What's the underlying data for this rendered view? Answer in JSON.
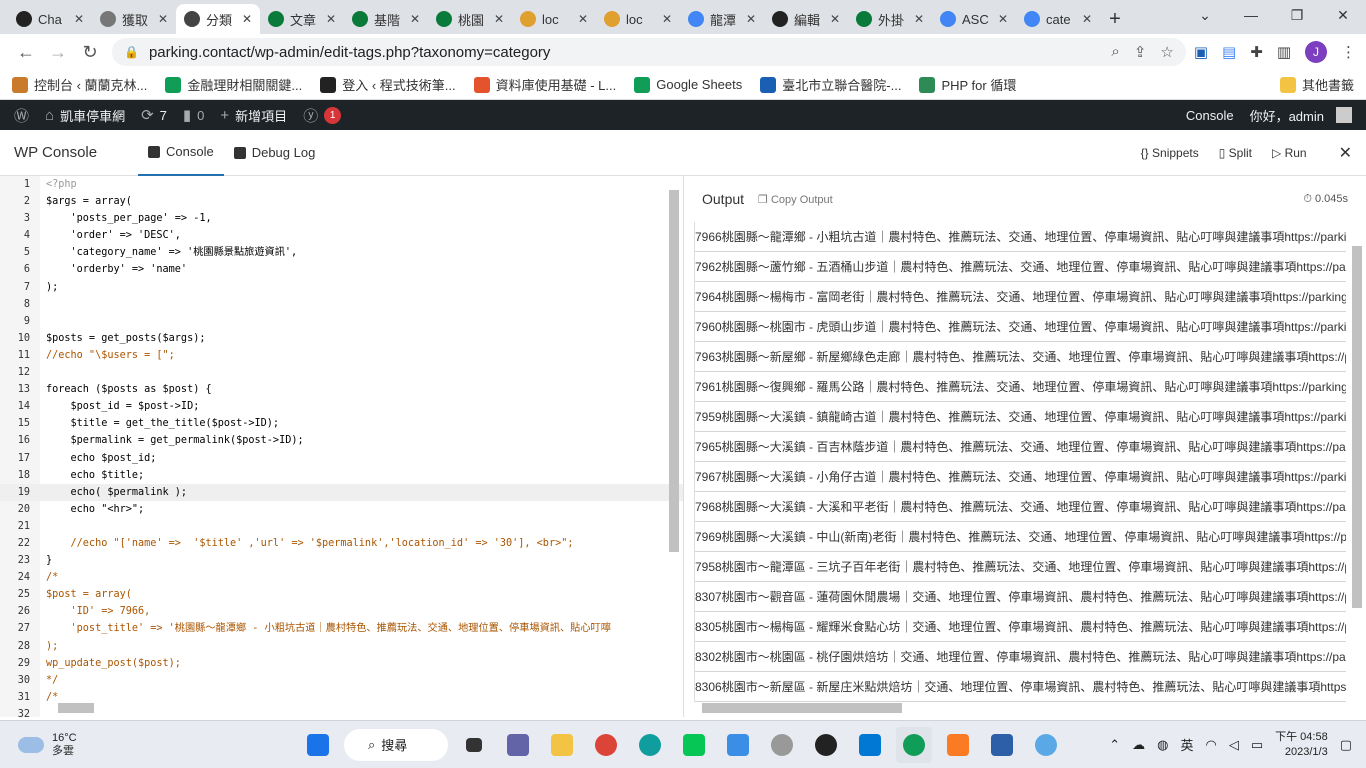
{
  "browser": {
    "tabs": [
      {
        "label": "Cha",
        "color": "#222"
      },
      {
        "label": "獲取",
        "color": "#777"
      },
      {
        "label": "分類",
        "color": "#444"
      },
      {
        "label": "文章",
        "color": "#0a7a3a"
      },
      {
        "label": "基階",
        "color": "#0a7a3a"
      },
      {
        "label": "桃園",
        "color": "#0a7a3a"
      },
      {
        "label": "loc",
        "color": "#e0a030"
      },
      {
        "label": "loc",
        "color": "#e0a030"
      },
      {
        "label": "龍潭",
        "color": "#4285f4"
      },
      {
        "label": "編輯",
        "color": "#222"
      },
      {
        "label": "外掛",
        "color": "#0a7a3a"
      },
      {
        "label": "ASC",
        "color": "#4285f4"
      },
      {
        "label": "cate",
        "color": "#4285f4"
      }
    ],
    "active_tab_index": 2,
    "new_tab": "+",
    "url": "parking.contact/wp-admin/edit-tags.php?taxonomy=category",
    "profile_initial": "J",
    "bookmarks": [
      {
        "label": "控制台 ‹ 蘭蘭克林...",
        "color": "#c97a2b"
      },
      {
        "label": "金融理財相關關鍵...",
        "color": "#0f9d58"
      },
      {
        "label": "登入 ‹ 程式技術筆...",
        "color": "#222"
      },
      {
        "label": "資料庫使用基礎 - L...",
        "color": "#e4532b"
      },
      {
        "label": "Google Sheets",
        "color": "#0f9d58"
      },
      {
        "label": "臺北市立聯合醫院-...",
        "color": "#1a5fb4"
      },
      {
        "label": "PHP for 循環",
        "color": "#2e8b57"
      }
    ],
    "other_bookmarks": "其他書籤"
  },
  "adminbar": {
    "site_name": "凱車停車網",
    "updates_count": "7",
    "comments_count": "0",
    "new_item": "新增項目",
    "notification_count": "1",
    "console_label": "Console",
    "greeting": "你好，admin"
  },
  "console": {
    "title": "WP Console",
    "tabs": [
      "Console",
      "Debug Log"
    ],
    "actions": {
      "snippets": "Snippets",
      "split": "Split",
      "run": "Run"
    }
  },
  "editor": {
    "current_line": 19,
    "lines": [
      {
        "n": "1",
        "code": "<?php",
        "cls": "c-php"
      },
      {
        "n": "2",
        "code": "$args = array(",
        "cls": ""
      },
      {
        "n": "3",
        "code": "    'posts_per_page' => -1,",
        "cls": ""
      },
      {
        "n": "4",
        "code": "    'order' => 'DESC',",
        "cls": ""
      },
      {
        "n": "5",
        "code": "    'category_name' => '桃園縣景點旅遊資訊',",
        "cls": ""
      },
      {
        "n": "6",
        "code": "    'orderby' => 'name'",
        "cls": ""
      },
      {
        "n": "7",
        "code": ");",
        "cls": ""
      },
      {
        "n": "8",
        "code": "",
        "cls": ""
      },
      {
        "n": "9",
        "code": "",
        "cls": ""
      },
      {
        "n": "10",
        "code": "$posts = get_posts($args);",
        "cls": ""
      },
      {
        "n": "11",
        "code": "//echo \"\\$users = [\";",
        "cls": "c-com"
      },
      {
        "n": "12",
        "code": "",
        "cls": ""
      },
      {
        "n": "13",
        "code": "foreach ($posts as $post) {",
        "cls": ""
      },
      {
        "n": "14",
        "code": "    $post_id = $post->ID;",
        "cls": ""
      },
      {
        "n": "15",
        "code": "    $title = get_the_title($post->ID);",
        "cls": ""
      },
      {
        "n": "16",
        "code": "    $permalink = get_permalink($post->ID);",
        "cls": ""
      },
      {
        "n": "17",
        "code": "    echo $post_id;",
        "cls": ""
      },
      {
        "n": "18",
        "code": "    echo $title;",
        "cls": ""
      },
      {
        "n": "19",
        "code": "    echo( $permalink );",
        "cls": ""
      },
      {
        "n": "20",
        "code": "    echo \"<hr>\";",
        "cls": ""
      },
      {
        "n": "21",
        "code": "",
        "cls": ""
      },
      {
        "n": "22",
        "code": "    //echo \"['name' =>  '$title' ,'url' => '$permalink','location_id' => '30'], <br>\";",
        "cls": "c-com"
      },
      {
        "n": "23",
        "code": "}",
        "cls": ""
      },
      {
        "n": "24",
        "code": "/*",
        "cls": "c-com"
      },
      {
        "n": "25",
        "code": "$post = array(",
        "cls": "c-com"
      },
      {
        "n": "26",
        "code": "    'ID' => 7966,",
        "cls": "c-com"
      },
      {
        "n": "27",
        "code": "    'post_title' => '桃園縣～龍潭鄉 - 小粗坑古道｜農村特色、推薦玩法、交通、地理位置、停車場資訊、貼心叮嚀",
        "cls": "c-com"
      },
      {
        "n": "28",
        "code": ");",
        "cls": "c-com"
      },
      {
        "n": "29",
        "code": "wp_update_post($post);",
        "cls": "c-com"
      },
      {
        "n": "30",
        "code": "*/",
        "cls": "c-com"
      },
      {
        "n": "31",
        "code": "/*",
        "cls": "c-com"
      },
      {
        "n": "32",
        "code": "",
        "cls": ""
      }
    ]
  },
  "output": {
    "title": "Output",
    "copy_label": "Copy Output",
    "timing": "0.045s",
    "rows": [
      "7966桃園縣～龍潭鄉 - 小粗坑古道｜農村特色、推薦玩法、交通、地理位置、停車場資訊、貼心叮嚀與建議事項https://parki",
      "7962桃園縣～蘆竹鄉 - 五酒桶山步道｜農村特色、推薦玩法、交通、地理位置、停車場資訊、貼心叮嚀與建議事項https://par",
      "7964桃園縣～楊梅市 - 富岡老街｜農村特色、推薦玩法、交通、地理位置、停車場資訊、貼心叮嚀與建議事項https://parking",
      "7960桃園縣～桃園市 - 虎頭山步道｜農村特色、推薦玩法、交通、地理位置、停車場資訊、貼心叮嚀與建議事項https://parki",
      "7963桃園縣～新屋鄉 - 新屋鄉綠色走廊｜農村特色、推薦玩法、交通、地理位置、停車場資訊、貼心叮嚀與建議事項https://p",
      "7961桃園縣～復興鄉 - 羅馬公路｜農村特色、推薦玩法、交通、地理位置、停車場資訊、貼心叮嚀與建議事項https://parking",
      "7959桃園縣～大溪鎮 - 鎮龍崎古道｜農村特色、推薦玩法、交通、地理位置、停車場資訊、貼心叮嚀與建議事項https://parki",
      "7965桃園縣～大溪鎮 - 百吉林蔭步道｜農村特色、推薦玩法、交通、地理位置、停車場資訊、貼心叮嚀與建議事項https://par",
      "7967桃園縣～大溪鎮 - 小角仔古道｜農村特色、推薦玩法、交通、地理位置、停車場資訊、貼心叮嚀與建議事項https://parki",
      "7968桃園縣～大溪鎮 - 大溪和平老街｜農村特色、推薦玩法、交通、地理位置、停車場資訊、貼心叮嚀與建議事項https://par",
      "7969桃園縣～大溪鎮 - 中山(新南)老街｜農村特色、推薦玩法、交通、地理位置、停車場資訊、貼心叮嚀與建議事項https://p",
      "7958桃園市～龍潭區 - 三坑子百年老街｜農村特色、推薦玩法、交通、地理位置、停車場資訊、貼心叮嚀與建議事項https://p",
      "8307桃園市～觀音區 - 蓮荷園休閒農場｜交通、地理位置、停車場資訊、農村特色、推薦玩法、貼心叮嚀與建議事項https://p",
      "8305桃園市～楊梅區 - 耀輝米食點心坊｜交通、地理位置、停車場資訊、農村特色、推薦玩法、貼心叮嚀與建議事項https://p",
      "8302桃園市～桃園區 - 桃仔園烘焙坊｜交通、地理位置、停車場資訊、農村特色、推薦玩法、貼心叮嚀與建議事項https://par",
      "8306桃園市～新屋區 - 新屋庄米點烘焙坊｜交通、地理位置、停車場資訊、農村特色、推薦玩法、貼心叮嚀與建議事項https:/"
    ]
  },
  "taskbar": {
    "temperature": "16°C",
    "weather_text": "多雲",
    "search_label": "搜尋",
    "ime": "英",
    "time": "下午 04:58",
    "date": "2023/1/3"
  }
}
